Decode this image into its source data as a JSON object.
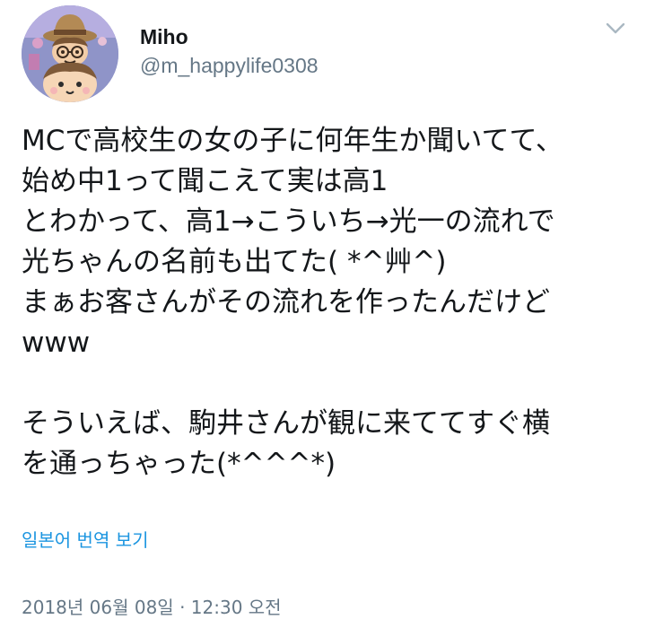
{
  "tweet": {
    "display_name": "Miho",
    "handle": "@m_happylife0308",
    "text": "MCで高校生の女の子に何年生か聞いてて、\n始め中1って聞こえて実は高1\nとわかって、高1→こういち→光一の流れで\n光ちゃんの名前も出てた( *^艸^)\nまぁお客さんがその流れを作ったんだけど\nwww\n\nそういえば、駒井さんが観に来ててすぐ横\nを通っちゃった(*^^^*)",
    "translate_label": "일본어 번역 보기",
    "timestamp": "2018년 06월 08일 · 12:30 오전"
  },
  "icons": {
    "avatar": "avatar-image",
    "menu": "chevron-down-icon"
  },
  "colors": {
    "text": "#14171a",
    "secondary": "#657786",
    "link": "#1b95e0",
    "chevron": "#aab8c2"
  }
}
